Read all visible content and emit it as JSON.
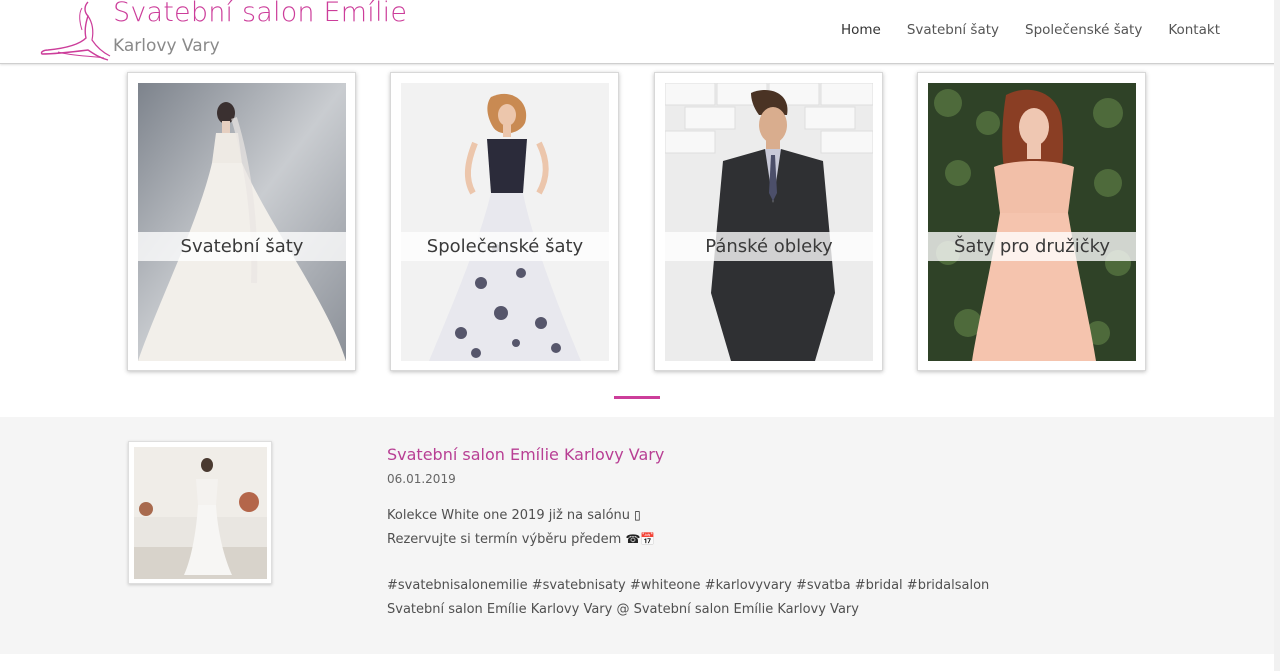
{
  "header": {
    "logo_title": "Svatební salon Emílie",
    "logo_subtitle": "Karlovy Vary",
    "nav": [
      {
        "label": "Home"
      },
      {
        "label": "Svatební šaty"
      },
      {
        "label": "Společenské šaty"
      },
      {
        "label": "Kontakt"
      }
    ]
  },
  "categories": [
    {
      "label": "Svatební šaty"
    },
    {
      "label": "Společenské šaty"
    },
    {
      "label": "Pánské obleky"
    },
    {
      "label": "Šaty pro družičky"
    }
  ],
  "post": {
    "title": "Svatební salon Emílie Karlovy Vary",
    "date": "06.01.2019",
    "line1": "Kolekce White one 2019 již na salónu",
    "line1_glyph": "▯",
    "line2": "Rezervujte si termín výběru předem",
    "line2_glyph": "☎📅",
    "tags": "#svatebnisalonemilie #svatebnisaty #whiteone #karlovyvary #svatba #bridal #bridalsalon",
    "line4": "Svatební salon Emílie Karlovy Vary @ Svatební salon Emílie Karlovy Vary"
  },
  "colors": {
    "brand": "#cc3d9a",
    "post_title": "#b83f94",
    "news_bg": "#f5f5f5"
  }
}
